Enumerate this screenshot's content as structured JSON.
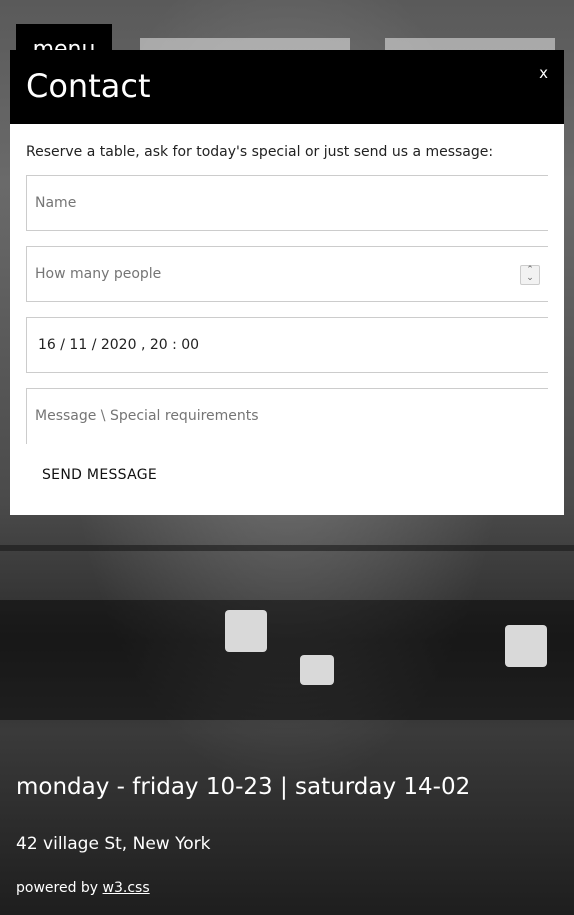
{
  "menu_button": {
    "label": "menu"
  },
  "modal": {
    "title": "Contact",
    "close_label": "x",
    "intro": "Reserve a table, ask for today's special or just send us a message:",
    "fields": {
      "name_placeholder": "Name",
      "people_placeholder": "How many people",
      "datetime_value": "16 / 11 / 2020 ,  20 : 00",
      "message_placeholder": "Message \\ Special requirements"
    },
    "send_label": "SEND MESSAGE"
  },
  "footer": {
    "hours": "monday - friday 10-23 | saturday 14-02",
    "address": "42 village St, New York",
    "powered_prefix": "powered by ",
    "powered_link": "w3.css"
  }
}
